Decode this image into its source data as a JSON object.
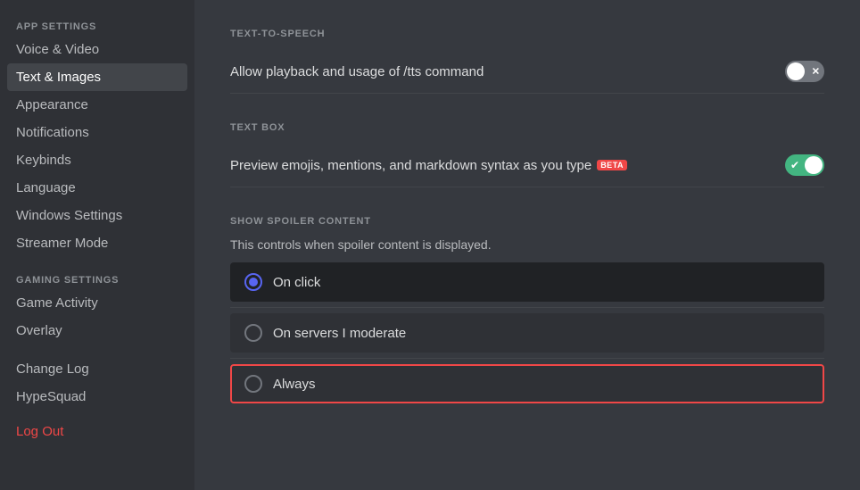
{
  "sidebar": {
    "app_settings_label": "APP SETTINGS",
    "gaming_settings_label": "GAMING SETTINGS",
    "items": [
      {
        "label": "Voice & Video",
        "id": "voice-video",
        "active": false
      },
      {
        "label": "Text & Images",
        "id": "text-images",
        "active": true
      },
      {
        "label": "Appearance",
        "id": "appearance",
        "active": false
      },
      {
        "label": "Notifications",
        "id": "notifications",
        "active": false
      },
      {
        "label": "Keybinds",
        "id": "keybinds",
        "active": false
      },
      {
        "label": "Language",
        "id": "language",
        "active": false
      },
      {
        "label": "Windows Settings",
        "id": "windows-settings",
        "active": false
      },
      {
        "label": "Streamer Mode",
        "id": "streamer-mode",
        "active": false
      }
    ],
    "gaming_items": [
      {
        "label": "Game Activity",
        "id": "game-activity",
        "active": false
      },
      {
        "label": "Overlay",
        "id": "overlay",
        "active": false
      }
    ],
    "extra_items": [
      {
        "label": "Change Log",
        "id": "change-log",
        "active": false
      },
      {
        "label": "HypeSquad",
        "id": "hypesquad",
        "active": false
      }
    ],
    "logout_label": "Log Out"
  },
  "main": {
    "tts_section_label": "TEXT-TO-SPEECH",
    "tts_setting_label": "Allow playback and usage of /tts command",
    "tts_toggle_state": "off",
    "textbox_section_label": "TEXT BOX",
    "textbox_setting_label": "Preview emojis, mentions, and markdown syntax as you type",
    "beta_label": "BETA",
    "textbox_toggle_state": "on",
    "spoiler_section_label": "SHOW SPOILER CONTENT",
    "spoiler_desc": "This controls when spoiler content is displayed.",
    "radio_options": [
      {
        "label": "On click",
        "selected": true,
        "highlighted": false
      },
      {
        "label": "On servers I moderate",
        "selected": false,
        "highlighted": false
      },
      {
        "label": "Always",
        "selected": false,
        "highlighted": true
      }
    ]
  }
}
